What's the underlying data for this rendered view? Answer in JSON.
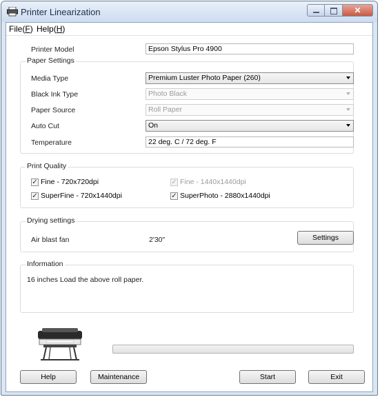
{
  "window": {
    "title": "Printer Linearization"
  },
  "menu": {
    "file": "File",
    "file_key": "F",
    "help": "Help",
    "help_key": "H"
  },
  "printer_model": {
    "label": "Printer Model",
    "value": "Epson Stylus Pro 4900"
  },
  "paper_settings": {
    "legend": "Paper Settings",
    "media_type": {
      "label": "Media Type",
      "value": "Premium Luster Photo Paper (260)"
    },
    "black_ink_type": {
      "label": "Black Ink Type",
      "value": "Photo Black"
    },
    "paper_source": {
      "label": "Paper Source",
      "value": "Roll Paper"
    },
    "auto_cut": {
      "label": "Auto Cut",
      "value": "On"
    },
    "temperature": {
      "label": "Temperature",
      "value": "22 deg. C / 72 deg. F"
    }
  },
  "print_quality": {
    "legend": "Print Quality",
    "options": [
      {
        "label": "Fine - 720x720dpi",
        "checked": true,
        "enabled": true
      },
      {
        "label": "Fine - 1440x1440dpi",
        "checked": true,
        "enabled": false
      },
      {
        "label": "SuperFine - 720x1440dpi",
        "checked": true,
        "enabled": true
      },
      {
        "label": "SuperPhoto - 2880x1440dpi",
        "checked": true,
        "enabled": true
      }
    ]
  },
  "drying": {
    "legend": "Drying settings",
    "air_blast_label": "Air blast fan",
    "air_blast_value": "2'30\"",
    "settings_button": "Settings"
  },
  "information": {
    "legend": "Information",
    "text": "16 inches Load the above roll paper."
  },
  "progress": {
    "value": 0
  },
  "buttons": {
    "help": "Help",
    "maintenance": "Maintenance",
    "start": "Start",
    "exit": "Exit"
  },
  "icons": {
    "app": "printer-icon",
    "illustration": "large-format-printer-icon",
    "check": "✓",
    "close": "✕"
  }
}
